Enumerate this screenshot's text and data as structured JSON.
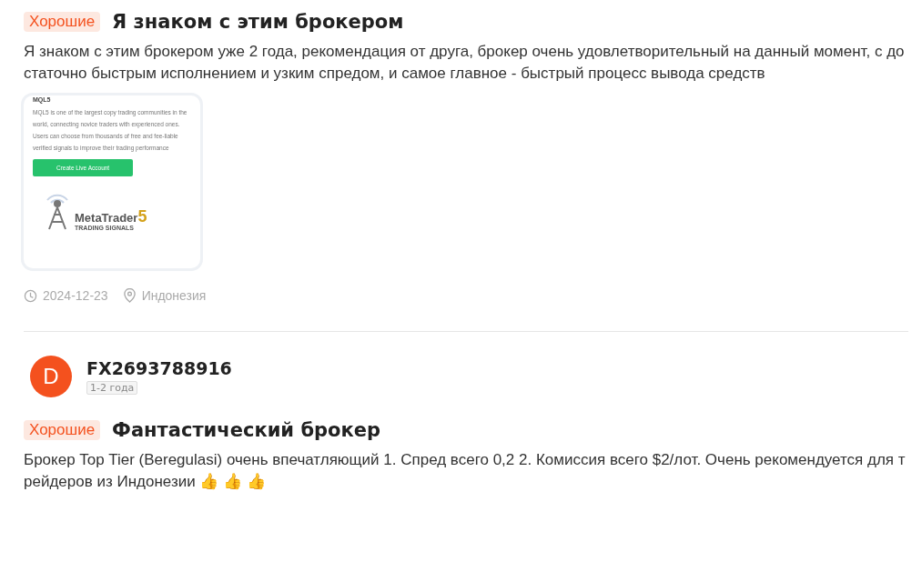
{
  "reviews": [
    {
      "tag": "Хорошие",
      "title": "Я знаком с этим брокером",
      "text": "Я знаком с этим брокером уже 2 года, рекомендация от друга, брокер очень удовлетворительный на данный момент, с достаточно быстрым исполнением и узким спредом, и самое главное - быстрый процесс вывода средств",
      "screenshot": {
        "heading": "MQL5",
        "paragraph": "MQL5 is one of the largest copy trading communities in the world, connecting novice traders with experienced ones. Users can choose from thousands of free and fee-liable verified signals to improve their trading performance",
        "button": "Create Live Account",
        "logo_name": "MetaTrader",
        "logo_number": "5",
        "logo_sub": "TRADING SIGNALS"
      },
      "date": "2024-12-23",
      "location": "Индонезия"
    },
    {
      "user": {
        "initial": "D",
        "name": "FX2693788916",
        "tenure": "1-2 года"
      },
      "tag": "Хорошие",
      "title": "Фантастический брокер",
      "text": "Брокер Top Tier (Beregulasi) очень впечатляющий 1. Спред всего 0,2 2. Комиссия всего $2/лот. Очень рекомендуется для трейдеров из Индонезии 👍 👍 👍"
    }
  ]
}
